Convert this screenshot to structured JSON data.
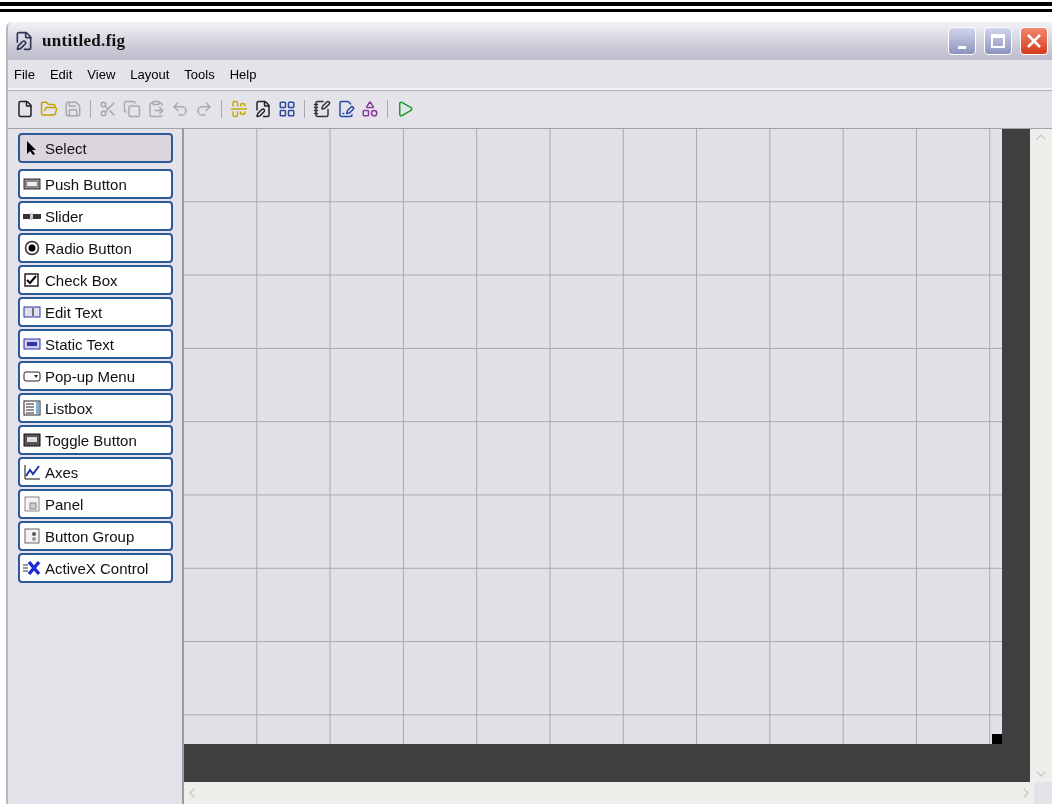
{
  "window": {
    "title": "untitled.fig"
  },
  "menu": [
    "File",
    "Edit",
    "View",
    "Layout",
    "Tools",
    "Help"
  ],
  "toolbar": [
    [
      {
        "disabled": false
      },
      {
        "disabled": false
      },
      {
        "disabled": true
      }
    ],
    [
      {
        "disabled": true
      },
      {
        "disabled": true
      },
      {
        "disabled": true
      },
      {
        "disabled": true
      },
      {
        "disabled": true
      }
    ],
    [
      {
        "disabled": false
      },
      {
        "disabled": false
      },
      {
        "disabled": false
      }
    ],
    [
      {
        "disabled": false
      },
      {
        "disabled": false
      },
      {
        "disabled": false
      }
    ],
    [
      {
        "disabled": false
      }
    ]
  ],
  "palette": [
    {
      "label": "Select",
      "selected": true
    },
    {
      "label": "Push Button",
      "selected": false
    },
    {
      "label": "Slider",
      "selected": false
    },
    {
      "label": "Radio Button",
      "selected": false
    },
    {
      "label": "Check Box",
      "selected": false
    },
    {
      "label": "Edit Text",
      "selected": false
    },
    {
      "label": "Static Text",
      "selected": false
    },
    {
      "label": "Pop-up Menu",
      "selected": false
    },
    {
      "label": "Listbox",
      "selected": false
    },
    {
      "label": "Toggle Button",
      "selected": false
    },
    {
      "label": "Axes",
      "selected": false
    },
    {
      "label": "Panel",
      "selected": false
    },
    {
      "label": "Button Group",
      "selected": false
    },
    {
      "label": "ActiveX Control",
      "selected": false
    }
  ]
}
